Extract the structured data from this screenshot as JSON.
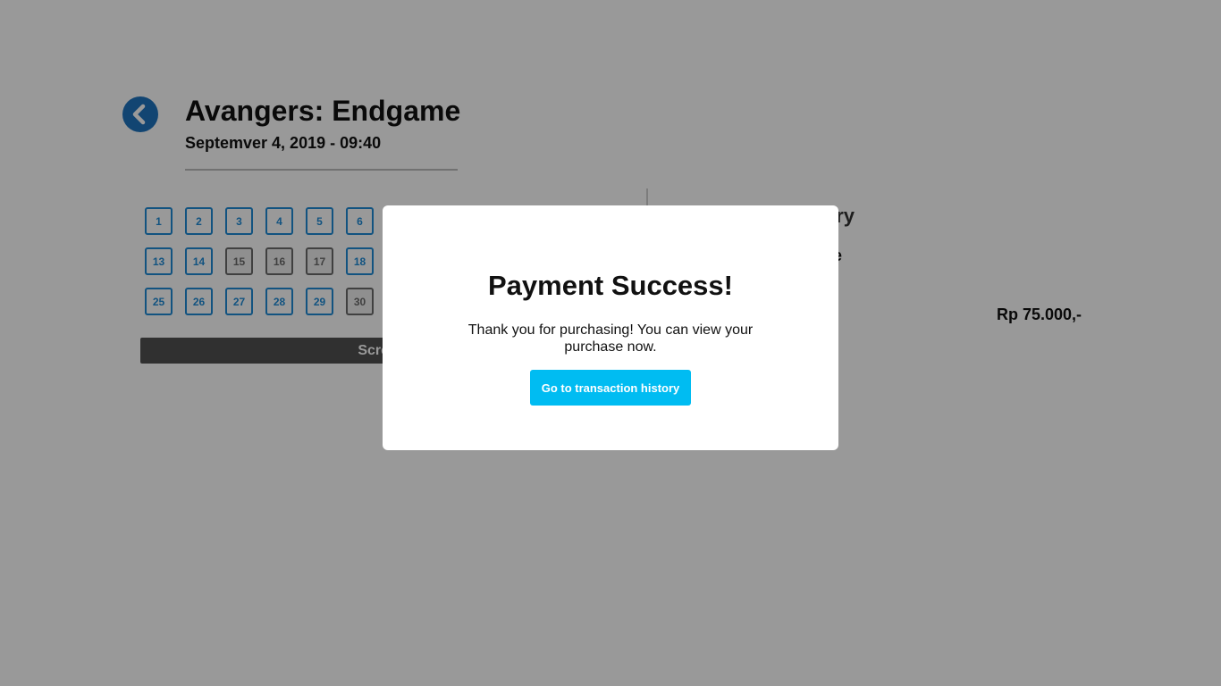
{
  "header": {
    "movie_title": "Avangers: Endgame",
    "showtime": "Septemver 4, 2019 - 09:40"
  },
  "seats": [
    {
      "label": "1",
      "status": "available"
    },
    {
      "label": "2",
      "status": "available"
    },
    {
      "label": "3",
      "status": "available"
    },
    {
      "label": "4",
      "status": "available"
    },
    {
      "label": "5",
      "status": "available"
    },
    {
      "label": "6",
      "status": "available"
    },
    {
      "label": "13",
      "status": "available"
    },
    {
      "label": "14",
      "status": "available"
    },
    {
      "label": "15",
      "status": "taken"
    },
    {
      "label": "16",
      "status": "taken"
    },
    {
      "label": "17",
      "status": "taken"
    },
    {
      "label": "18",
      "status": "available"
    },
    {
      "label": "25",
      "status": "available"
    },
    {
      "label": "26",
      "status": "available"
    },
    {
      "label": "27",
      "status": "available"
    },
    {
      "label": "28",
      "status": "available"
    },
    {
      "label": "29",
      "status": "available"
    },
    {
      "label": "30",
      "status": "taken"
    }
  ],
  "screen_label": "Screen",
  "summary": {
    "title_fragment": "ry",
    "label_fragment": "e",
    "price": "Rp 75.000,-"
  },
  "modal": {
    "title": "Payment Success!",
    "message": "Thank you for purchasing! You can view your purchase now.",
    "button_label": "Go to transaction history"
  },
  "colors": {
    "accent": "#1e73be",
    "seat_available": "#1e8ad6",
    "seat_taken": "#6b6b6b",
    "button": "#00bcf2",
    "overlay": "rgba(0,0,0,0.4)"
  }
}
